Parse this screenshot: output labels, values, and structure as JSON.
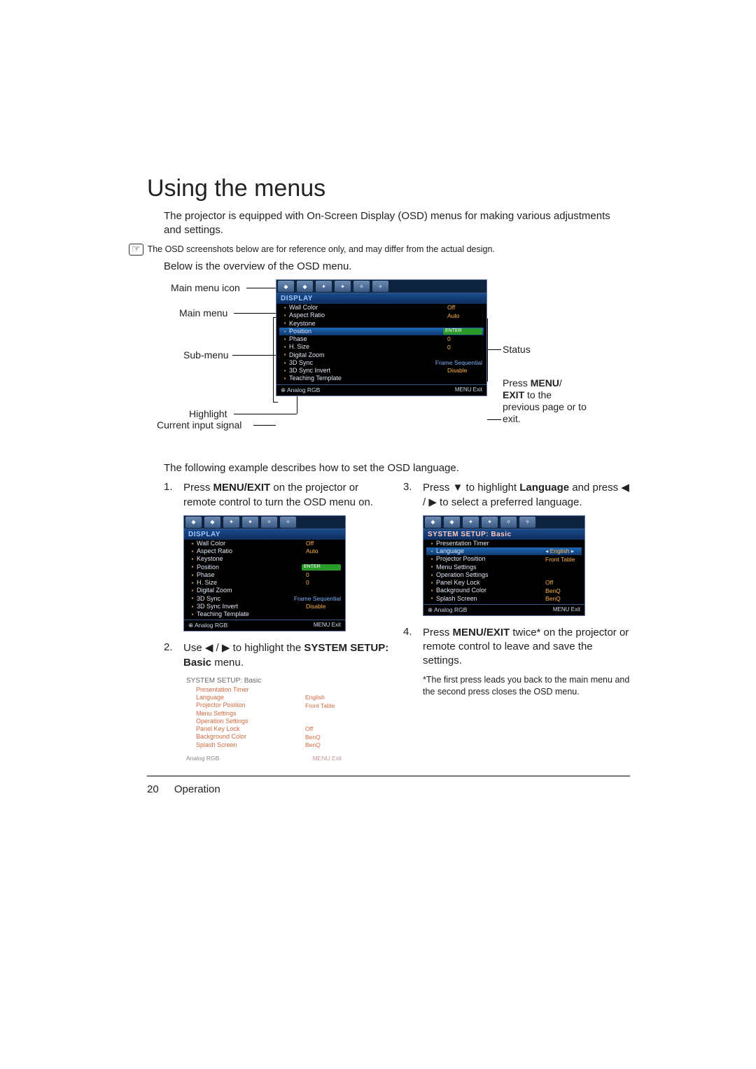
{
  "heading": "Using the menus",
  "intro": "The projector is equipped with On-Screen Display (OSD) menus for making various adjustments and settings.",
  "note1": "The OSD screenshots below are for reference only, and may differ from the actual design.",
  "overview_lead": "Below is the overview of the OSD menu.",
  "labels": {
    "main_icon": "Main menu icon",
    "main_menu": "Main menu",
    "sub_menu": "Sub-menu",
    "highlight": "Highlight",
    "current_input": "Current input signal",
    "status": "Status",
    "press_menu": "Press ",
    "press_menu_b1": "MENU",
    "press_menu_mid": "/",
    "press_menu_b2": "EXIT",
    "press_menu_tail": " to the previous page or to exit."
  },
  "example_lead": "The following example describes how to set the OSD language.",
  "steps": {
    "s1a": "Press ",
    "s1b": "MENU/EXIT",
    "s1c": " on the projector or remote control to turn the OSD menu on.",
    "s2a": "Use ",
    "s2b": " to highlight the ",
    "s2c": "SYSTEM SETUP: Basic",
    "s2d": " menu.",
    "s3a": "Press ",
    "s3b": " to highlight ",
    "s3c": "Language",
    "s3d": " and press ",
    "s3e": " to select a preferred language.",
    "s4a": "Press ",
    "s4b": "MENU/EXIT",
    "s4c": " twice* on the projector or remote control to leave and save the settings."
  },
  "footnote": "*The first press leads you back to the main menu and the second press closes the OSD menu.",
  "osd": {
    "display": {
      "title": "DISPLAY",
      "rows": [
        {
          "k": "Wall Color",
          "v": "Off"
        },
        {
          "k": "Aspect Ratio",
          "v": "Auto"
        },
        {
          "k": "Keystone",
          "v": ""
        },
        {
          "k": "Position",
          "v": "ENTER",
          "sel": true
        },
        {
          "k": "Phase",
          "v": "0"
        },
        {
          "k": "H. Size",
          "v": "0"
        },
        {
          "k": "Digital Zoom",
          "v": ""
        },
        {
          "k": "3D Sync",
          "v": "Frame Sequential",
          "blue": true
        },
        {
          "k": "3D Sync Invert",
          "v": "Disable"
        },
        {
          "k": "Teaching Template",
          "v": ""
        }
      ],
      "foot_l": "Analog RGB",
      "foot_r": "MENU  Exit"
    },
    "setup": {
      "title": "SYSTEM SETUP: Basic",
      "rows": [
        {
          "k": "Presentation Timer",
          "v": ""
        },
        {
          "k": "Language",
          "v": "English",
          "sel": true,
          "arr": true
        },
        {
          "k": "Projector Position",
          "v": "Front Table"
        },
        {
          "k": "Menu Settings",
          "v": ""
        },
        {
          "k": "Operation Settings",
          "v": ""
        },
        {
          "k": "Panel Key Lock",
          "v": "Off"
        },
        {
          "k": "Background Color",
          "v": "BenQ"
        },
        {
          "k": "Splash Screen",
          "v": "BenQ"
        }
      ],
      "foot_l": "Analog RGB",
      "foot_r": "MENU  Exit"
    }
  },
  "footer": {
    "page": "20",
    "section": "Operation"
  }
}
